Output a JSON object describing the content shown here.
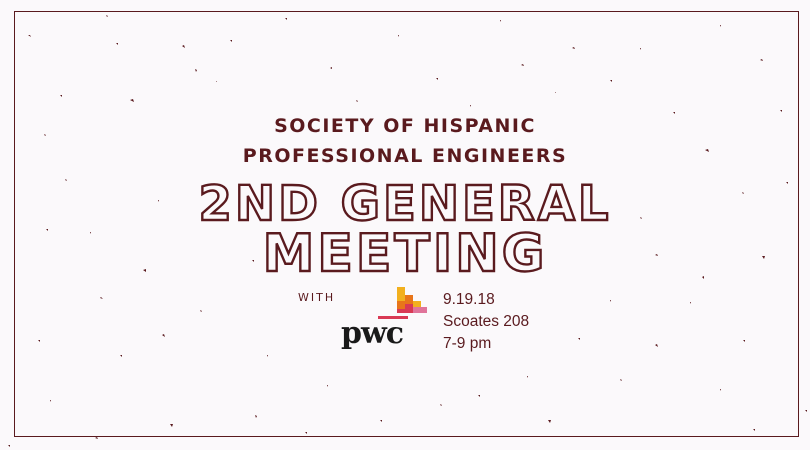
{
  "organization": {
    "line1": "SOCIETY OF HISPANIC",
    "line2": "PROFESSIONAL ENGINEERS"
  },
  "event": {
    "title_line1": "2ND GENERAL",
    "title_line2": "MEETING"
  },
  "sponsor": {
    "with_label": "WITH",
    "name": "pwc"
  },
  "details": {
    "date": "9.19.18",
    "location": "Scoates 208",
    "time": "7-9 pm"
  },
  "colors": {
    "accent": "#5a1a1e",
    "background": "#fbf9fb",
    "logo_orange": "#e8751a",
    "logo_yellow": "#f2b01e",
    "logo_red": "#d93954",
    "logo_pink": "#e0749a"
  }
}
